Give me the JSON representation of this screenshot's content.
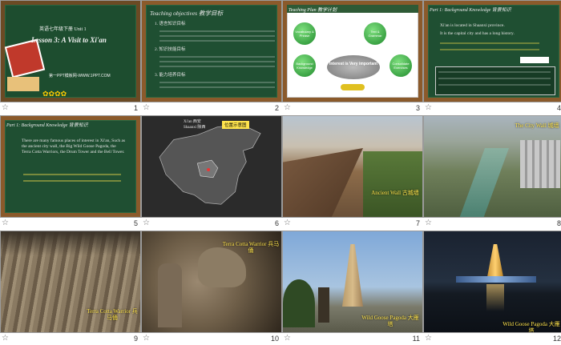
{
  "slides": [
    {
      "num": "1",
      "subtitle": "英语七年级下册 Unit 1",
      "title": "Lesson 3: A Visit to Xi'an",
      "watermark": "第一PPT模板网-WWW.1PPT.COM"
    },
    {
      "num": "2",
      "heading": "Teaching objectives  教学目标",
      "items": [
        "1. 语言知识目标",
        "2. 知识技能目标",
        "3. 能力培养目标"
      ]
    },
    {
      "num": "3",
      "heading": "Teaching Plan  教学计划",
      "center": "Interest is Very important",
      "circles": [
        "Vocabulary & Phrase",
        "Text & Grammar",
        "Background Knowledge",
        "Consolidate Exercises"
      ]
    },
    {
      "num": "4",
      "heading": "Part 1: Background Knowledge  背景知识",
      "lines": [
        "Xi'an is located in Shaanxi province.",
        "It is the capital city and has a long history."
      ]
    },
    {
      "num": "5",
      "heading": "Part 1: Background Knowledge  背景知识",
      "text": "There are many famous places of interest in Xi'an, Such as the ancient city wall, the Big Wild Goose Pagoda, the Terra Cotta Warriors, the Drum Tower and the Bell Tower."
    },
    {
      "num": "6",
      "label": "位置示意图",
      "legend": [
        "Xi'an  西安",
        "Shaanxi  陕西"
      ]
    },
    {
      "num": "7",
      "caption": "Ancient Wall 古城墙"
    },
    {
      "num": "8",
      "caption": "The City Wall 城墙"
    },
    {
      "num": "9",
      "caption": "Terra Cotta Warrior 兵马俑"
    },
    {
      "num": "10",
      "caption": "Terra Cotta Warrior 兵马俑"
    },
    {
      "num": "11",
      "caption": "Wild Goose Pagoda 大雁塔"
    },
    {
      "num": "12",
      "caption": "Wild Goose Pagoda 大雁塔"
    }
  ],
  "star_icon": "☆"
}
